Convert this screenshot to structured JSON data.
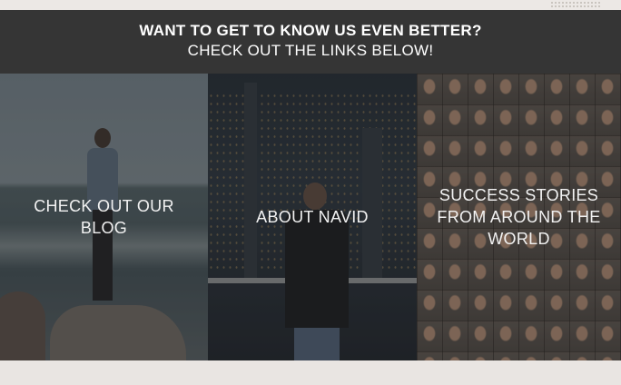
{
  "banner": {
    "title": "WANT TO GET TO KNOW US EVEN BETTER?",
    "subtitle": "CHECK OUT THE LINKS BELOW!"
  },
  "panels": [
    {
      "label": "CHECK OUT OUR BLOG",
      "image": "ocean-rocks-photo"
    },
    {
      "label": "ABOUT NAVID",
      "image": "city-night-photo"
    },
    {
      "label": "SUCCESS STORIES FROM AROUND THE WORLD",
      "image": "faces-collage-photo"
    }
  ]
}
